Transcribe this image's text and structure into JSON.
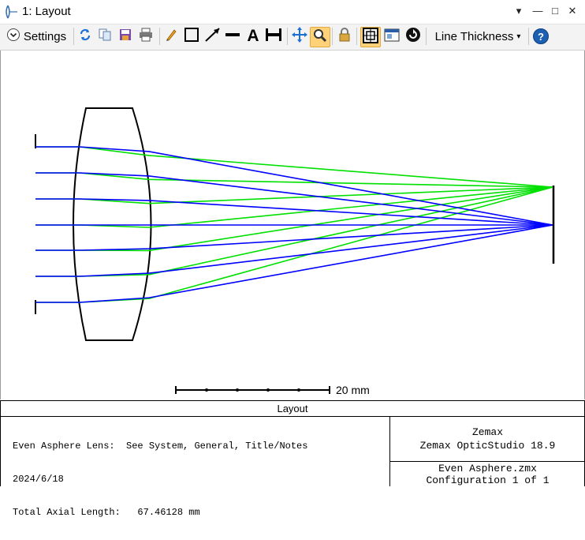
{
  "window": {
    "title": "1: Layout",
    "controls": [
      "▾",
      "—",
      "□",
      "✕"
    ]
  },
  "toolbar": {
    "settings_label": "Settings",
    "line_thickness_label": "Line Thickness",
    "line_thickness_caret": "▾",
    "help_label": "?",
    "text_tool_label": "A",
    "icons": [
      "refresh-icon",
      "copy-icon",
      "save-icon",
      "print-icon",
      "pencil-icon",
      "rectangle-icon",
      "arrow-icon",
      "line-icon",
      "text-icon",
      "dimension-icon",
      "pan-icon",
      "zoom-icon",
      "lock-icon",
      "fit-icon",
      "window-icon",
      "rotate-icon",
      "help-icon"
    ],
    "accent": "#ffd27a"
  },
  "plot": {
    "scale_label": "20 mm",
    "colors": {
      "field1": "#0000ff",
      "field2": "#00e000",
      "lens": "#000000"
    },
    "field_count": 2,
    "rays_per_field": 7
  },
  "info": {
    "title": "Layout",
    "description": "Even Asphere Lens:  See System, General, Title/Notes",
    "date": "2024/6/18",
    "total_length": "Total Axial Length:   67.46128 mm",
    "company": "Zemax",
    "product": "Zemax OpticStudio 18.9",
    "file": "Even Asphere.zmx",
    "config": "Configuration 1 of 1"
  }
}
